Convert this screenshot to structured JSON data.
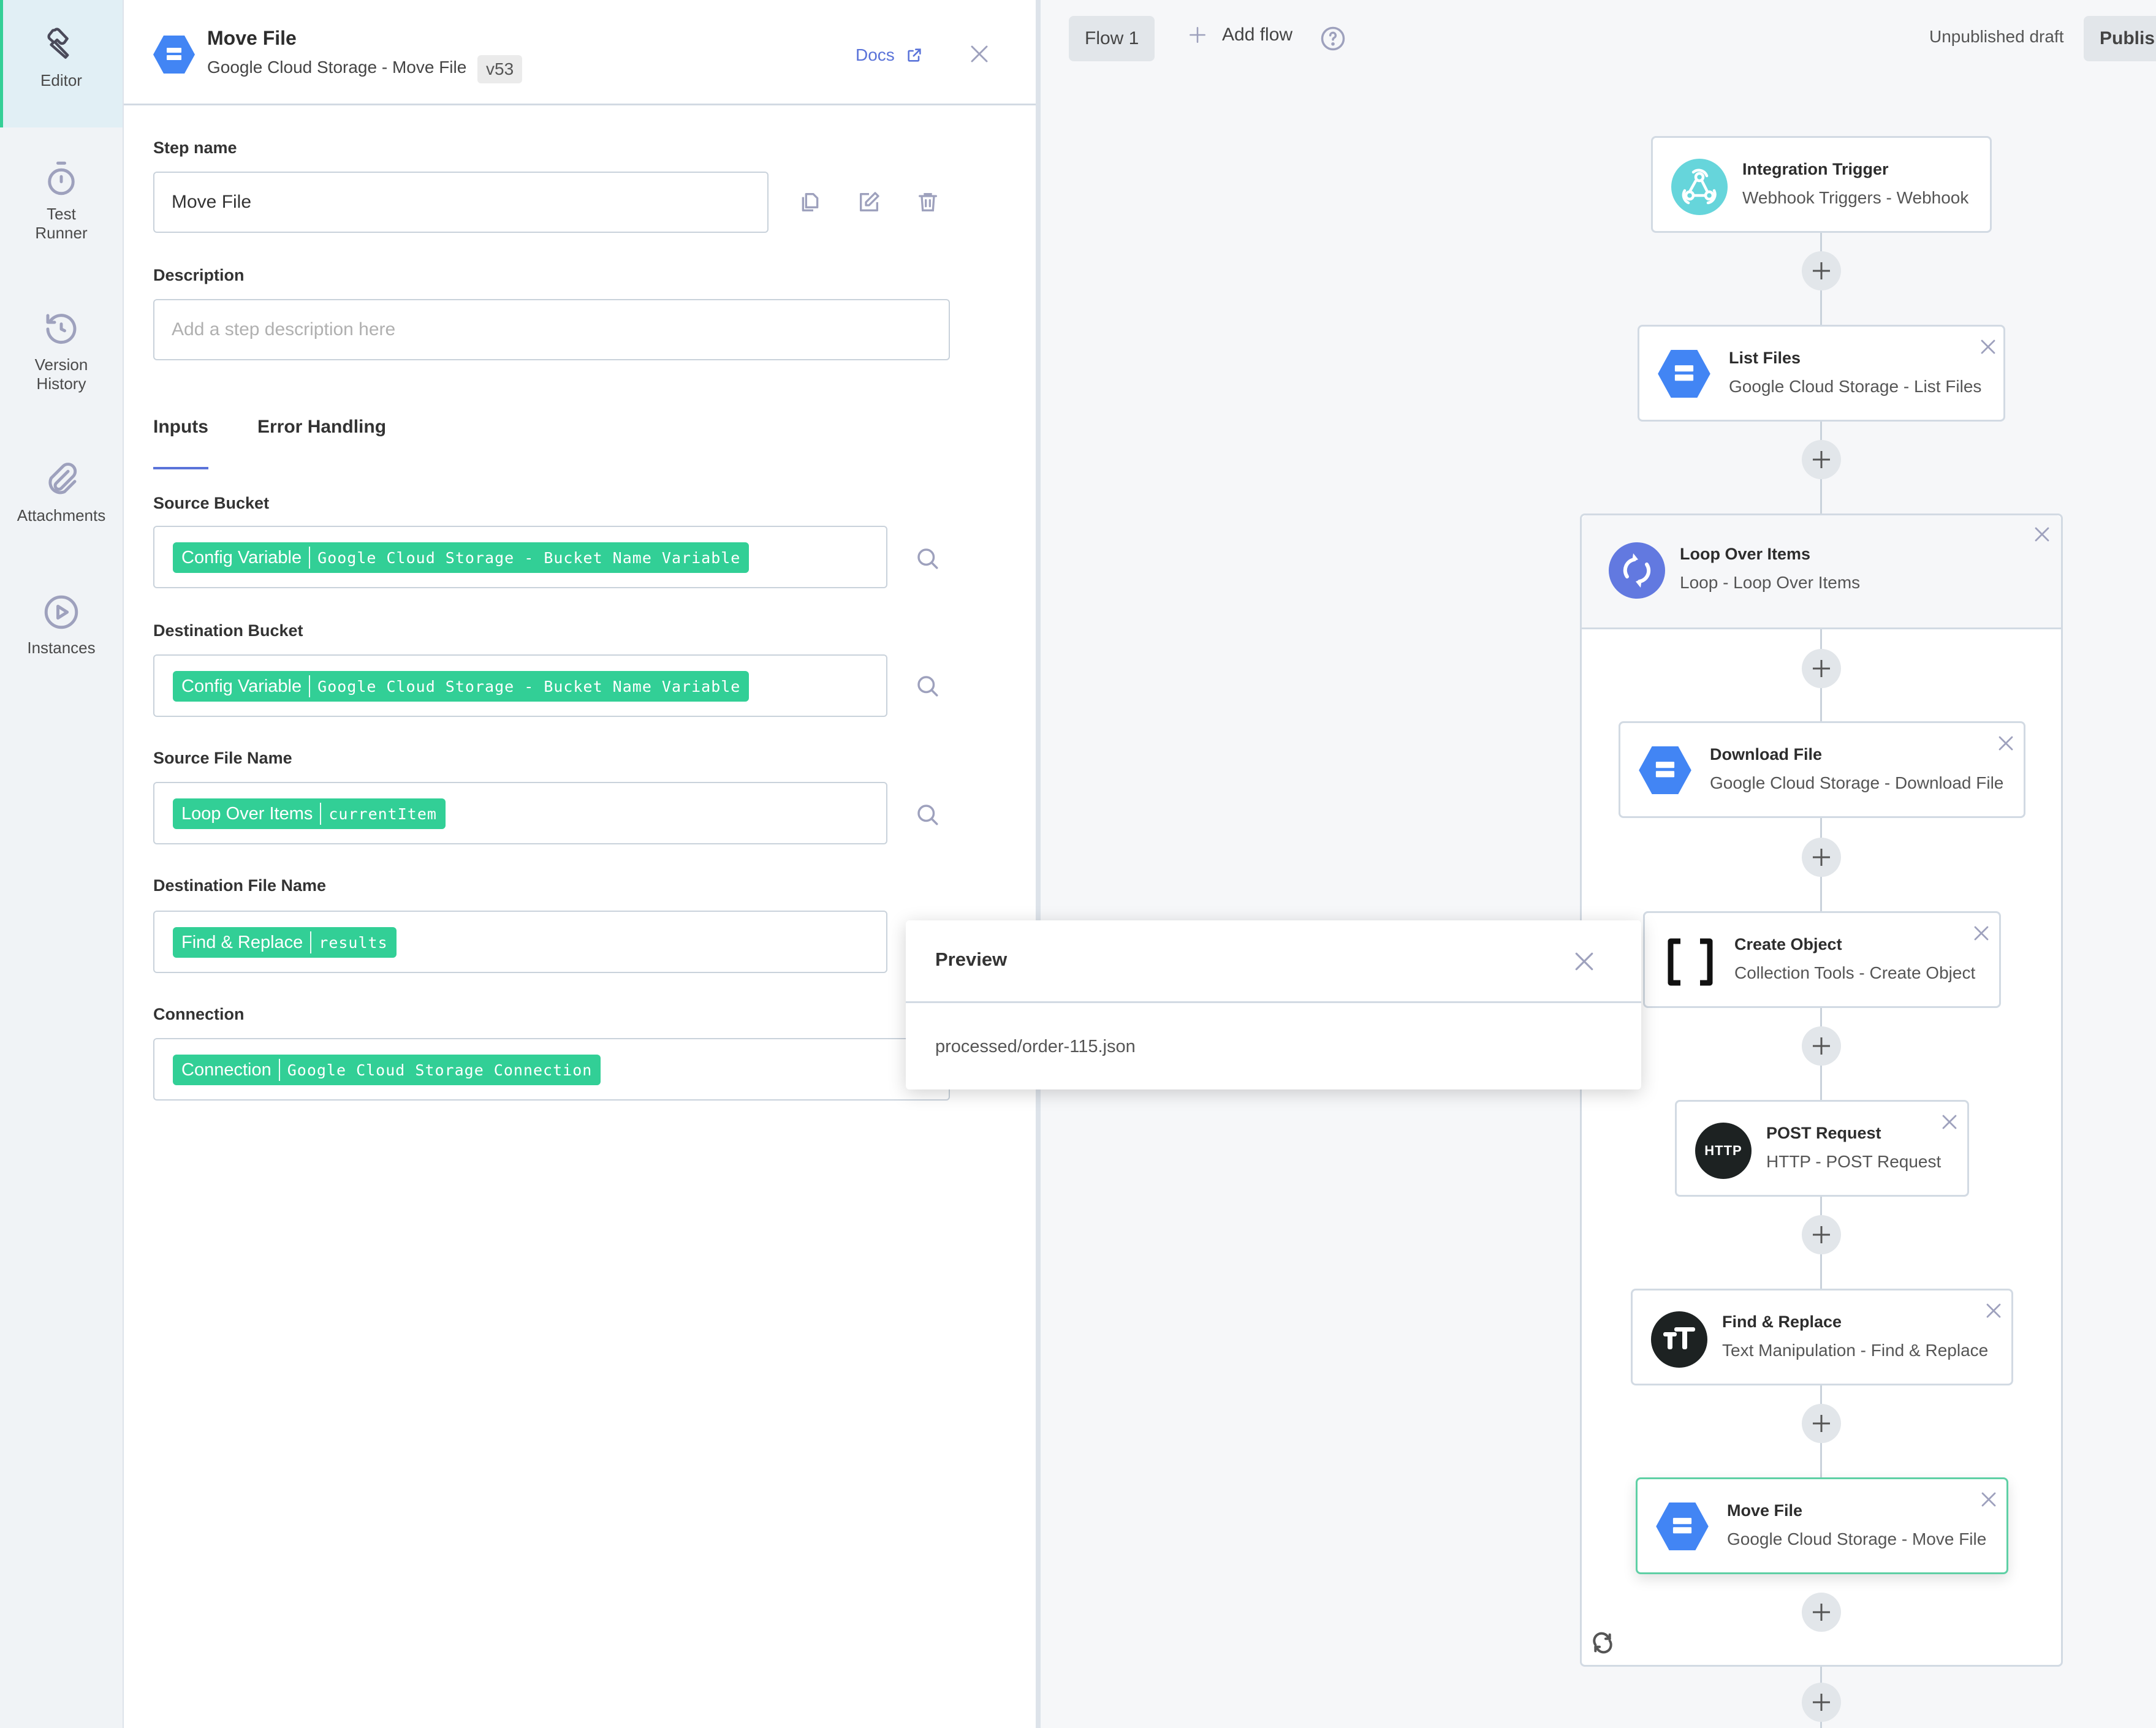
{
  "nav": {
    "items": [
      {
        "label": "Editor",
        "icon": "wrench-icon",
        "active": true
      },
      {
        "label": "Test Runner",
        "icon": "stopwatch-icon",
        "active": false
      },
      {
        "label": "Version History",
        "icon": "history-icon",
        "active": false
      },
      {
        "label": "Attachments",
        "icon": "paperclip-icon",
        "active": false
      },
      {
        "label": "Instances",
        "icon": "play-circle-icon",
        "active": false
      }
    ]
  },
  "step_panel": {
    "title": "Move File",
    "subtitle": "Google Cloud Storage - Move File",
    "version": "v53",
    "docs_label": "Docs",
    "step_name_label": "Step name",
    "step_name_value": "Move File",
    "description_label": "Description",
    "description_placeholder": "Add a step description here",
    "tabs": [
      {
        "label": "Inputs",
        "active": true
      },
      {
        "label": "Error Handling",
        "active": false
      }
    ],
    "inputs": [
      {
        "label": "Source Bucket",
        "source": "Config Variable",
        "value": "Google Cloud Storage - Bucket Name Variable",
        "has_search": true
      },
      {
        "label": "Destination Bucket",
        "source": "Config Variable",
        "value": "Google Cloud Storage - Bucket Name Variable",
        "has_search": true
      },
      {
        "label": "Source File Name",
        "source": "Loop Over Items",
        "value": "currentItem",
        "has_search": true
      },
      {
        "label": "Destination File Name",
        "source": "Find & Replace",
        "value": "results",
        "has_search": false
      },
      {
        "label": "Connection",
        "source": "Connection",
        "value": "Google Cloud Storage Connection",
        "has_search": false
      }
    ]
  },
  "preview": {
    "title": "Preview",
    "value": "processed/order-115.json"
  },
  "canvas": {
    "flow_tab": "Flow 1",
    "add_flow_label": "Add flow",
    "draft_status": "Unpublished draft",
    "publish_label": "Publis",
    "nodes": [
      {
        "title": "Integration Trigger",
        "subtitle": "Webhook Triggers - Webhook",
        "icon": "webhook-icon"
      },
      {
        "title": "List Files",
        "subtitle": "Google Cloud Storage - List Files",
        "icon": "gcs-icon"
      },
      {
        "title": "Loop Over Items",
        "subtitle": "Loop - Loop Over Items",
        "icon": "loop-icon"
      },
      {
        "title": "Download File",
        "subtitle": "Google Cloud Storage - Download File",
        "icon": "gcs-icon"
      },
      {
        "title": "Create Object",
        "subtitle": "Collection Tools - Create Object",
        "icon": "brackets-icon"
      },
      {
        "title": "POST Request",
        "subtitle": "HTTP - POST Request",
        "icon": "http-icon",
        "icon_text": "HTTP"
      },
      {
        "title": "Find & Replace",
        "subtitle": "Text Manipulation - Find & Replace",
        "icon": "text-icon"
      },
      {
        "title": "Move File",
        "subtitle": "Google Cloud Storage - Move File",
        "icon": "gcs-icon",
        "selected": true
      }
    ]
  },
  "colors": {
    "accent_green": "#32cf96",
    "link_blue": "#5a73d9",
    "gcs_blue": "#4285f4",
    "loop_purple": "#6279e0",
    "webhook_teal": "#66d5db"
  }
}
